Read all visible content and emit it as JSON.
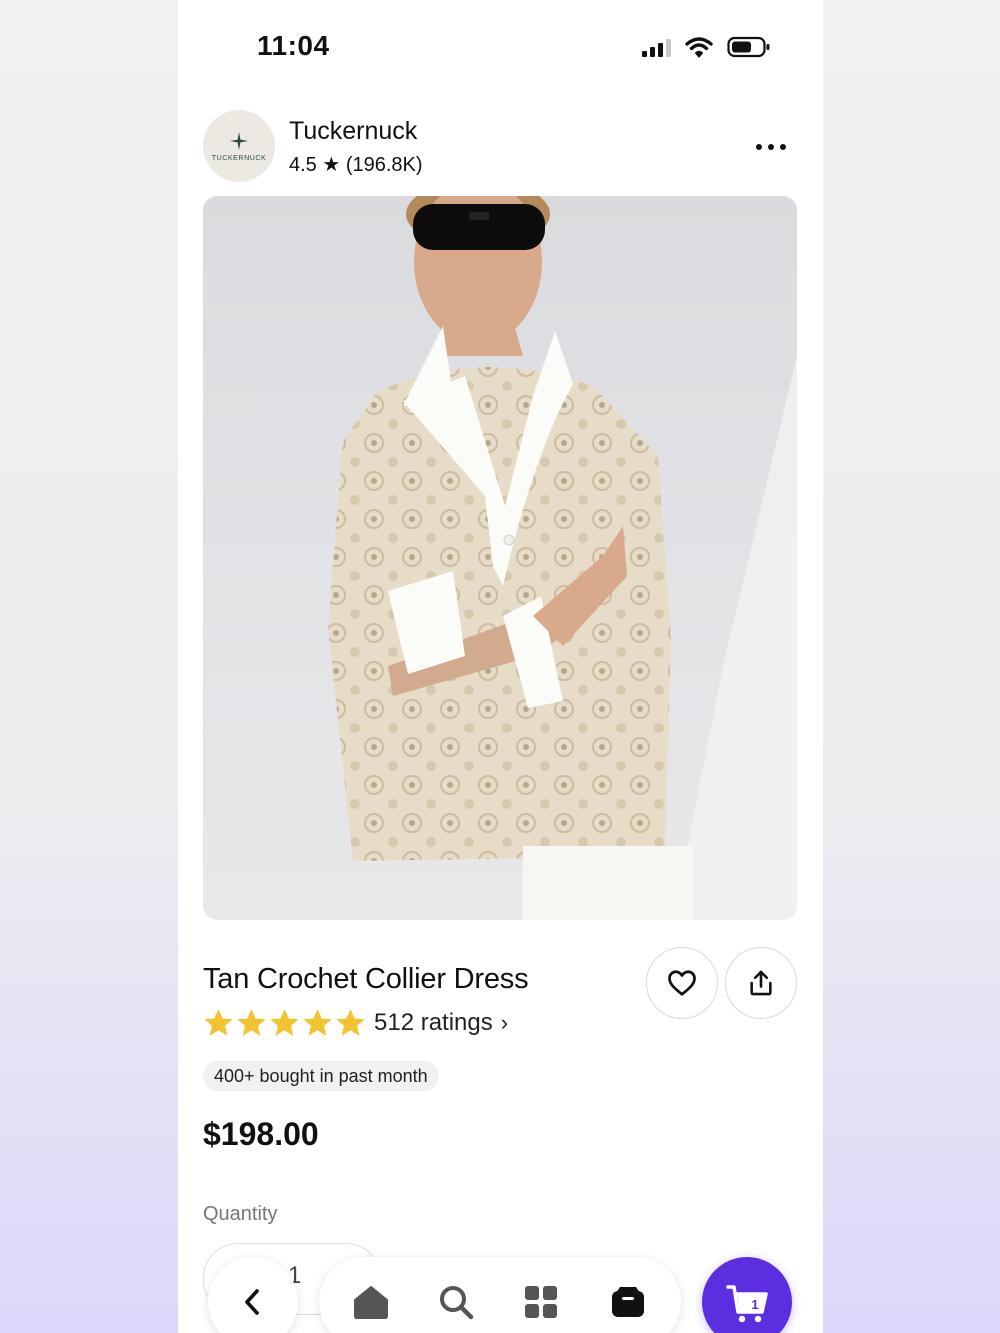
{
  "status_bar": {
    "time": "11:04",
    "icons": [
      "cellular-signal-icon",
      "wifi-icon",
      "battery-icon"
    ]
  },
  "store": {
    "name": "Tuckernuck",
    "rating": "4.5 ★ (196.8K)",
    "logo_text": "TUCKERNUCK",
    "more_icon": "more-horizontal-icon"
  },
  "product": {
    "image_alt": "Model wearing a tan crochet dress with a white collar and cuffs",
    "title": "Tan Crochet Collier Dress",
    "stars": 5,
    "ratings_label": "512 ratings",
    "ratings_chevron": "›",
    "bought_badge": "400+ bought in past month",
    "price": "$198.00",
    "quantity_label": "Quantity",
    "quantity_value": "1"
  },
  "actions": {
    "favorite_icon": "heart-icon",
    "share_icon": "share-icon"
  },
  "bottom_nav": {
    "back_icon": "chevron-left-icon",
    "items": [
      "home-icon",
      "search-icon",
      "categories-grid-icon",
      "orders-box-icon"
    ],
    "cart_count": "1"
  },
  "colors": {
    "accent": "#5b2ee0",
    "star": "#f2c230",
    "text": "#111111"
  }
}
